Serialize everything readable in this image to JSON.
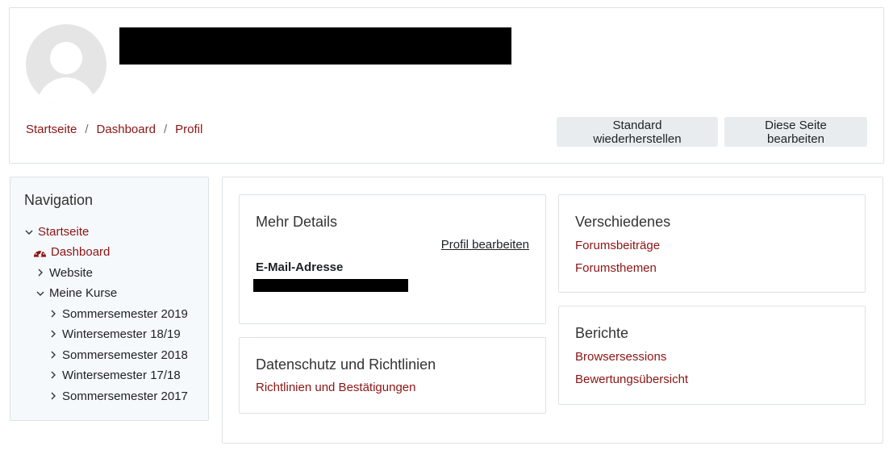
{
  "breadcrumb": [
    "Startseite",
    "Dashboard",
    "Profil"
  ],
  "breadcrumb_separator": "/",
  "header_buttons": {
    "reset": "Standard wiederherstellen",
    "edit": "Diese Seite bearbeiten"
  },
  "navigation": {
    "title": "Navigation",
    "items": [
      {
        "label": "Startseite",
        "icon": "chevron-down-icon"
      },
      {
        "label": "Dashboard",
        "icon": "dashboard-gauge-icon"
      },
      {
        "label": "Website",
        "icon": "chevron-right-icon"
      },
      {
        "label": "Meine Kurse",
        "icon": "chevron-down-icon"
      },
      {
        "label": "Sommersemester 2019",
        "icon": "chevron-right-icon"
      },
      {
        "label": "Wintersemester 18/19",
        "icon": "chevron-right-icon"
      },
      {
        "label": "Sommersemester 2018",
        "icon": "chevron-right-icon"
      },
      {
        "label": "Wintersemester 17/18",
        "icon": "chevron-right-icon"
      },
      {
        "label": "Sommersemester 2017",
        "icon": "chevron-right-icon"
      }
    ]
  },
  "details": {
    "title": "Mehr Details",
    "edit_link": "Profil bearbeiten",
    "email_label": "E-Mail-Adresse"
  },
  "privacy": {
    "title": "Datenschutz und Richtlinien",
    "link": "Richtlinien und Bestätigungen"
  },
  "misc": {
    "title": "Verschiedenes",
    "links": [
      "Forumsbeiträge",
      "Forumsthemen"
    ]
  },
  "reports": {
    "title": "Berichte",
    "links": [
      "Browsersessions",
      "Bewertungsübersicht"
    ]
  },
  "colors": {
    "link": "#8b1414",
    "button_bg": "#e9ecef",
    "nav_bg": "#f5f9fc",
    "border": "#dee2e6"
  }
}
